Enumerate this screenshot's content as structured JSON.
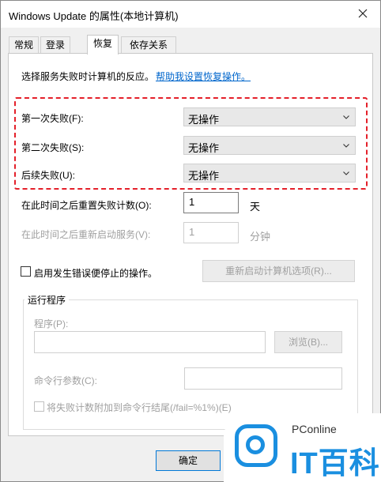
{
  "window": {
    "title": "Windows Update 的属性(本地计算机)"
  },
  "tabs": [
    {
      "label": "常规"
    },
    {
      "label": "登录"
    },
    {
      "label": "恢复"
    },
    {
      "label": "依存关系"
    }
  ],
  "recovery": {
    "intro": "选择服务失败时计算机的反应。",
    "help_link": "帮助我设置恢复操作。",
    "first_failure": {
      "label": "第一次失败(F):",
      "value": "无操作"
    },
    "second_failure": {
      "label": "第二次失败(S):",
      "value": "无操作"
    },
    "subsequent_failure": {
      "label": "后续失败(U):",
      "value": "无操作"
    },
    "reset_count": {
      "label": "在此时间之后重置失败计数(O):",
      "value": "1",
      "unit": "天"
    },
    "restart_service": {
      "label": "在此时间之后重新启动服务(V):",
      "value": "1",
      "unit": "分钟"
    },
    "enable_actions": {
      "label": "启用发生错误便停止的操作。",
      "checked": false
    },
    "restart_options_button": "重新启动计算机选项(R)...",
    "run_program": {
      "group_title": "运行程序",
      "program_label": "程序(P):",
      "program_value": "",
      "browse_button": "浏览(B)...",
      "cmd_label": "命令行参数(C):",
      "cmd_value": "",
      "append_label": "将失败计数附加到命令行结尾(/fail=%1%)(E)",
      "append_checked": false
    }
  },
  "footer": {
    "ok_button": "确定"
  },
  "watermark": {
    "small": "PConline",
    "brand": "IT百科"
  },
  "colors": {
    "highlight_border": "#e4202a",
    "link": "#0066cc",
    "watermark_blue": "#1a8fe0"
  }
}
